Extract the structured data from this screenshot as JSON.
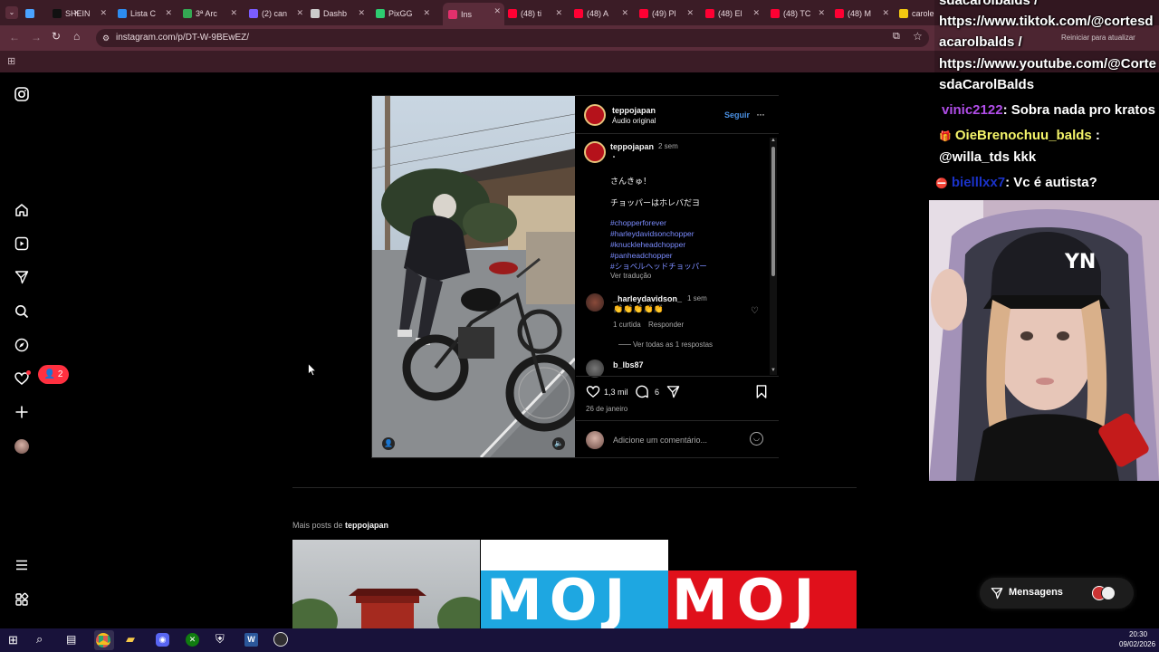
{
  "browser": {
    "tabs": [
      {
        "label": "",
        "color": "#4aa3ff"
      },
      {
        "label": "SHEIN",
        "color": "#111111"
      },
      {
        "label": "Lista C",
        "color": "#2d8cf0"
      },
      {
        "label": "3ª Arc",
        "color": "#34a853"
      },
      {
        "label": "(2) can",
        "color": "#7b5cff"
      },
      {
        "label": "Dashb",
        "color": "#cccccc"
      },
      {
        "label": "PixGG",
        "color": "#2ecc71"
      },
      {
        "label": "Ins",
        "color": "#e1306c"
      },
      {
        "label": "(48) ti",
        "color": "#ff0033"
      },
      {
        "label": "(48) A",
        "color": "#ff0033"
      },
      {
        "label": "(49) Pl",
        "color": "#ff0033"
      },
      {
        "label": "(48) El",
        "color": "#ff0033"
      },
      {
        "label": "(48) TC",
        "color": "#ff0033"
      },
      {
        "label": "(48) M",
        "color": "#ff0033"
      },
      {
        "label": "carole",
        "color": "#f2c811"
      }
    ],
    "url": "instagram.com/p/DT-W-9BEwEZ/",
    "restart_label": "Reiniciar para atualizar"
  },
  "sidebar": {
    "notification_count": "2"
  },
  "post": {
    "username": "teppojapan",
    "audio": "Áudio original",
    "follow": "Seguir",
    "caption_user": "teppojapan",
    "caption_time": "2 sem",
    "caption_dot": "・",
    "caption_lines": [
      "さんきゅ！",
      "チョッパーはホレバだヨ"
    ],
    "hashtags": [
      "#chopperforever",
      "#harleydavidsonchopper",
      "#knuckleheadchopper",
      "#panheadchopper",
      "#ショベルヘッドチョッパー"
    ],
    "translate": "Ver tradução",
    "comment1": {
      "user": "_harleydavidson_",
      "time": "1 sem",
      "text": "👏👏👏👏👏",
      "likes": "1 curtida",
      "reply": "Responder",
      "view_replies": "Ver todas as 1 respostas"
    },
    "comment2_user": "b_lbs87",
    "likes": "1,3 mil",
    "comments": "6",
    "date": "26 de janeiro",
    "add_comment": "Adicione um comentário..."
  },
  "more_posts": {
    "prefix": "Mais posts de",
    "user": "teppojapan",
    "thumb2_text": "MOJ",
    "thumb3_text": "MOJ"
  },
  "messages_label": "Mensagens",
  "chat": {
    "line1": "sdacarolbalds /",
    "line2": "https://www.tiktok.com/@cortesd",
    "line3": "acarolbalds /",
    "line4": "https://www.youtube.com/@Corte",
    "line5": "sdaCarolBalds",
    "user1": "vinic2122",
    "msg1": ": Sobra nada pro kratos",
    "user2": "OieBrenochuu_balds",
    "msg2a": ":",
    "msg2b": "@willa_tds kkk",
    "user3": "bielllxx7",
    "msg3": ": Vc é autista?"
  },
  "taskbar": {
    "time": "20:30",
    "date": "09/02/2026"
  }
}
